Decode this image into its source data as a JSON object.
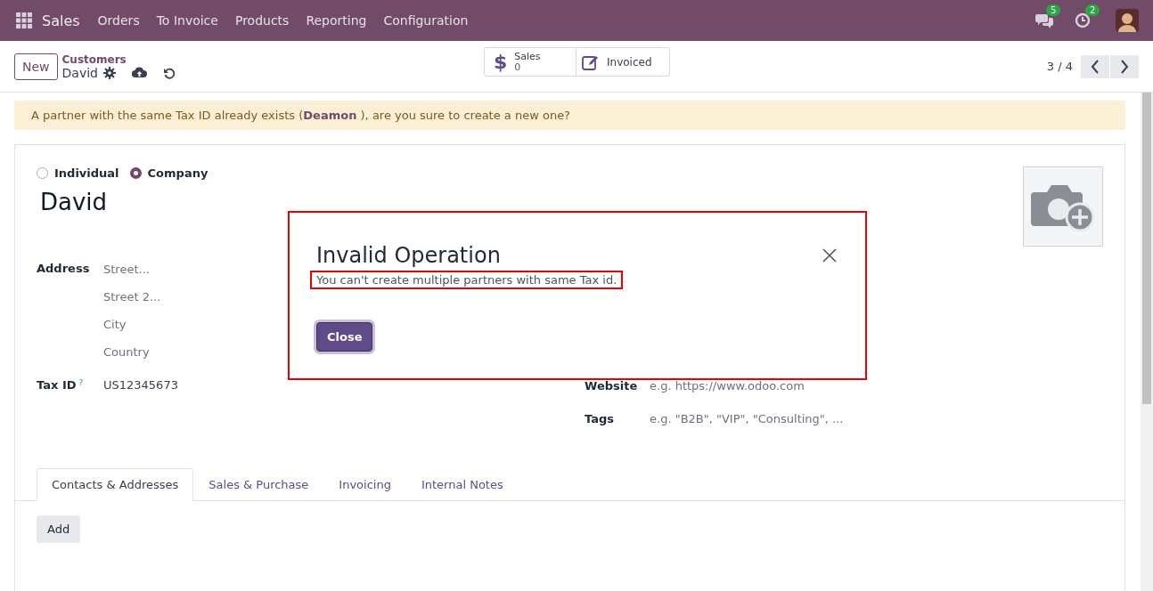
{
  "navbar": {
    "app": "Sales",
    "menu": [
      "Orders",
      "To Invoice",
      "Products",
      "Reporting",
      "Configuration"
    ],
    "messages_badge": "5",
    "activities_badge": "2"
  },
  "control_panel": {
    "new_button": "New",
    "breadcrumb": "Customers",
    "record": "David",
    "smart_buttons": [
      {
        "kind": "stat",
        "icon": "$",
        "label": "Sales",
        "value": "0"
      },
      {
        "kind": "plain",
        "label": "Invoiced"
      }
    ],
    "pager": "3 / 4"
  },
  "alert": {
    "before": "A partner with the same Tax ID already exists (",
    "link": "Deamon",
    "after": " ), are you sure to create a new one?"
  },
  "form": {
    "company_type": [
      {
        "label": "Individual",
        "selected": false
      },
      {
        "label": "Company",
        "selected": true
      }
    ],
    "name": "David",
    "address_label": "Address",
    "address_fields": [
      {
        "placeholder": "Street..."
      },
      {
        "placeholder": "Street 2..."
      },
      {
        "placeholder": "City"
      },
      {
        "placeholder": "Country"
      }
    ],
    "tax_id": {
      "label": "Tax ID",
      "help": "?",
      "value": "US12345673"
    },
    "right_fields": [
      {
        "label": "Website",
        "placeholder": "e.g. https://www.odoo.com"
      },
      {
        "label": "Tags",
        "placeholder": "e.g. \"B2B\", \"VIP\", \"Consulting\", ..."
      }
    ],
    "tabs": [
      {
        "label": "Contacts & Addresses",
        "selected": true
      },
      {
        "label": "Sales & Purchase",
        "selected": false
      },
      {
        "label": "Invoicing",
        "selected": false
      },
      {
        "label": "Internal Notes",
        "selected": false
      }
    ],
    "add_button": "Add"
  },
  "dialog": {
    "title": "Invalid Operation",
    "message": "You can't create multiple partners with same Tax id.",
    "close_button": "Close"
  }
}
